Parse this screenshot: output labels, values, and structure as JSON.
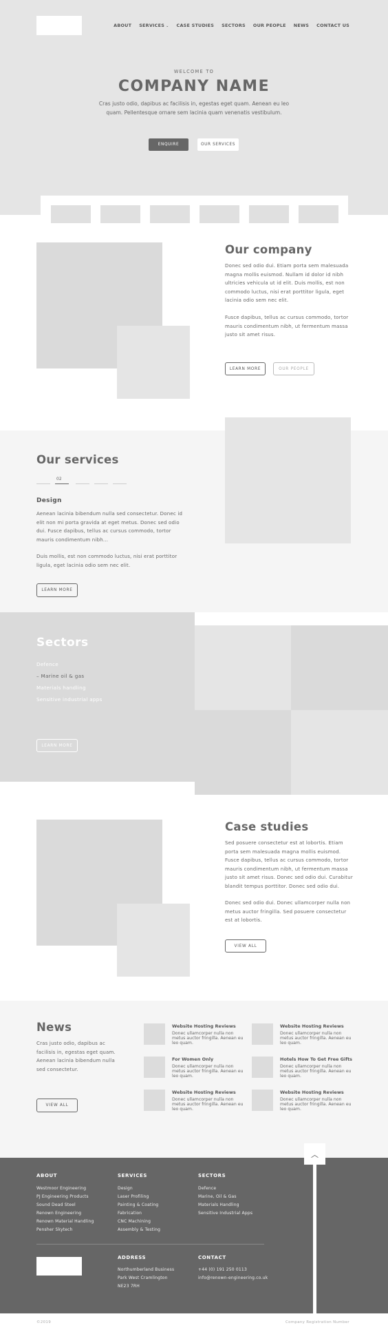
{
  "nav": {
    "items": [
      "ABOUT",
      "SERVICES",
      "CASE STUDIES",
      "SECTORS",
      "OUR PEOPLE",
      "NEWS",
      "CONTACT US"
    ]
  },
  "hero": {
    "welcome": "WELCOME TO",
    "title": "COMPANY NAME",
    "text": "Cras justo odio, dapibus ac facilisis in, egestas eget quam. Aenean eu leo quam. Pellentesque ornare sem lacinia quam venenatis vestibulum.",
    "enquire": "ENQUIRE",
    "our_services": "OUR SERVICES"
  },
  "company": {
    "title": "Our company",
    "p1": "Donec sed odio dui. Etiam porta sem malesuada magna mollis euismod. Nullam id dolor id nibh ultricies vehicula ut id elit. Duis mollis, est non commodo luctus, nisi erat porttitor ligula, eget lacinia odio sem nec elit.",
    "p2": "Fusce dapibus, tellus ac cursus commodo, tortor mauris condimentum nibh, ut fermentum massa justo sit amet risus.",
    "learn_more": "LEARN MORE",
    "our_people": "OUR PEOPLE"
  },
  "services": {
    "title": "Our services",
    "index": "02",
    "subtitle": "Design",
    "p1": "Aenean lacinia bibendum nulla sed consectetur. Donec id elit non mi porta gravida at eget metus. Donec sed odio dui. Fusce dapibus, tellus ac cursus commodo, tortor mauris condimentum nibh...",
    "p2": "Duis mollis, est non commodo luctus, nisi erat porttitor ligula, eget lacinia odio sem nec elit.",
    "learn_more": "LEARN MORE"
  },
  "sectors": {
    "title": "Sectors",
    "items": [
      "Defence",
      "– Marine oil & gas",
      "Materials handling",
      "Sensitive industrial apps"
    ],
    "learn_more": "LEARN MORE"
  },
  "case_studies": {
    "title": "Case studies",
    "p1": "Sed posuere consectetur est at lobortis. Etiam porta sem malesuada magna mollis euismod. Fusce dapibus, tellus ac cursus commodo, tortor mauris condimentum nibh, ut fermentum massa justo sit amet risus. Donec sed odio dui. Curabitur blandit tempus porttitor. Donec sed odio dui.",
    "p2": "Donec sed odio dui. Donec ullamcorper nulla non metus auctor fringilla. Sed posuere consectetur est at lobortis.",
    "view_all": "VIEW ALL"
  },
  "news": {
    "title": "News",
    "text": "Cras justo odio, dapibus ac facilisis in, egestas eget quam. Aenean lacinia bibendum nulla sed consectetur.",
    "view_all": "VIEW ALL",
    "items": [
      {
        "title": "Website Hosting Reviews",
        "desc": "Donec ullamcorper nulla non metus auctor fringilla. Aenean eu leo quam."
      },
      {
        "title": "Website Hosting Reviews",
        "desc": "Donec ullamcorper nulla non metus auctor fringilla. Aenean eu leo quam."
      },
      {
        "title": "For Women Only",
        "desc": "Donec ullamcorper nulla non metus auctor fringilla. Aenean eu leo quam."
      },
      {
        "title": "Hotels How To Get Free Gifts",
        "desc": "Donec ullamcorper nulla non metus auctor fringilla. Aenean eu leo quam."
      },
      {
        "title": "Website Hosting Reviews",
        "desc": "Donec ullamcorper nulla non metus auctor fringilla. Aenean eu leo quam."
      },
      {
        "title": "Website Hosting Reviews",
        "desc": "Donec ullamcorper nulla non metus auctor fringilla. Aenean eu leo quam."
      }
    ]
  },
  "footer": {
    "about": {
      "title": "ABOUT",
      "links": [
        "Westmoor Engineering",
        "PJ Engineering Products",
        "Sound Dead Steel",
        "Renown Engineering",
        "Renown Material Handling",
        "Pensher Skytech"
      ]
    },
    "services": {
      "title": "SERVICES",
      "links": [
        "Design",
        "Laser Profiling",
        "Painting & Coating",
        "Fabrication",
        "CNC Machining",
        "Assembly & Testing"
      ]
    },
    "sectors": {
      "title": "SECTORS",
      "links": [
        "Defence",
        "Marine, Oil & Gas",
        "Materials Handling",
        "Sensitive Industrial Apps"
      ]
    },
    "address": {
      "title": "ADDRESS",
      "lines": [
        "Northumberland Business",
        "Park West Cramlington",
        "NE23 7RH"
      ]
    },
    "contact": {
      "title": "CONTACT",
      "lines": [
        "+44 (0) 191 250 0113",
        "info@renown-engineering.co.uk"
      ]
    },
    "copyright": "©2019",
    "registration": "Company Registration Number"
  },
  "icons": {
    "to_top": "chevron-up-icon",
    "services_caret": "caret-down-icon"
  },
  "colors": {
    "dark": "#666666",
    "light_bg": "#f5f5f5",
    "placeholder": "#dadada"
  }
}
